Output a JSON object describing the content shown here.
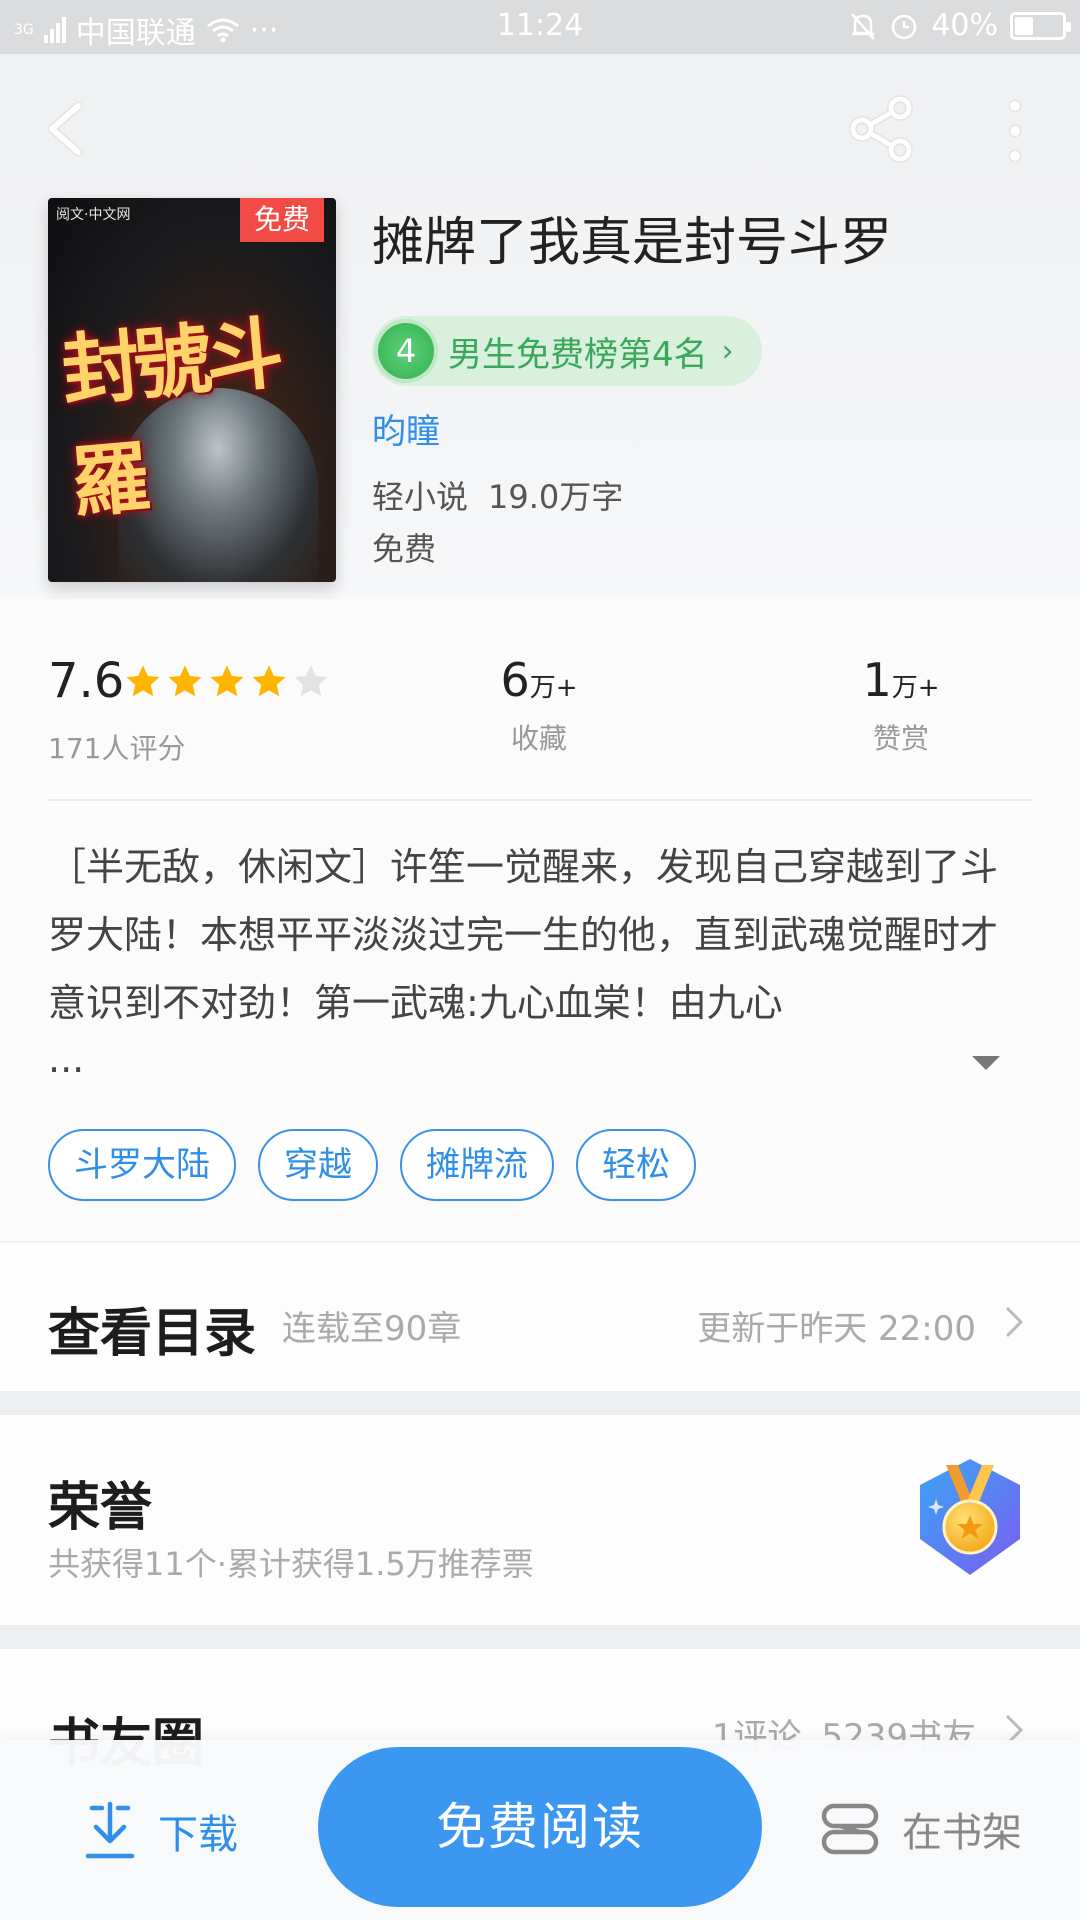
{
  "status_bar": {
    "network": "3G",
    "carrier": "中国联通",
    "dots": "···",
    "time": "11:24",
    "battery": "40%",
    "battery_level": 0.4
  },
  "book": {
    "title": "摊牌了我真是封号斗罗",
    "cover_badge": "免费",
    "cover_brand": "阅文·中文网",
    "cover_title": "封號斗羅",
    "rank_number": "4",
    "rank_text": "男生免费榜第4名",
    "author": "昀瞳",
    "category": "轻小说",
    "word_count": "19.0万字",
    "price": "免费"
  },
  "stats": {
    "score": "7.6",
    "rating_stars": 4,
    "raters": "171人评分",
    "collect_value": "6",
    "collect_unit": "万+",
    "collect_label": "收藏",
    "reward_value": "1",
    "reward_unit": "万+",
    "reward_label": "赞赏"
  },
  "description": {
    "text": "［半无敌，休闲文］许笙一觉醒来，发现自己穿越到了斗罗大陆！本想平平淡淡过完一生的他，直到武魂觉醒时才意识到不对劲！第一武魂:九心血棠！由九心",
    "more": "..."
  },
  "tags": [
    "斗罗大陆",
    "穿越",
    "摊牌流",
    "轻松"
  ],
  "catalog": {
    "title": "查看目录",
    "status": "连载至90章",
    "updated": "更新于昨天 22:00"
  },
  "honor": {
    "title": "荣誉",
    "summary": "共获得11个·累计获得1.5万推荐票"
  },
  "friends": {
    "title": "书友圈",
    "comments": "1评论",
    "members": "5239书友"
  },
  "bottom": {
    "download": "下载",
    "read": "免费阅读",
    "shelf": "在书架"
  },
  "colors": {
    "accent": "#3c97f1",
    "link": "#2f8fe8",
    "rank_green": "#3aa85a",
    "badge_red": "#f24a45",
    "star": "#ffb400"
  }
}
